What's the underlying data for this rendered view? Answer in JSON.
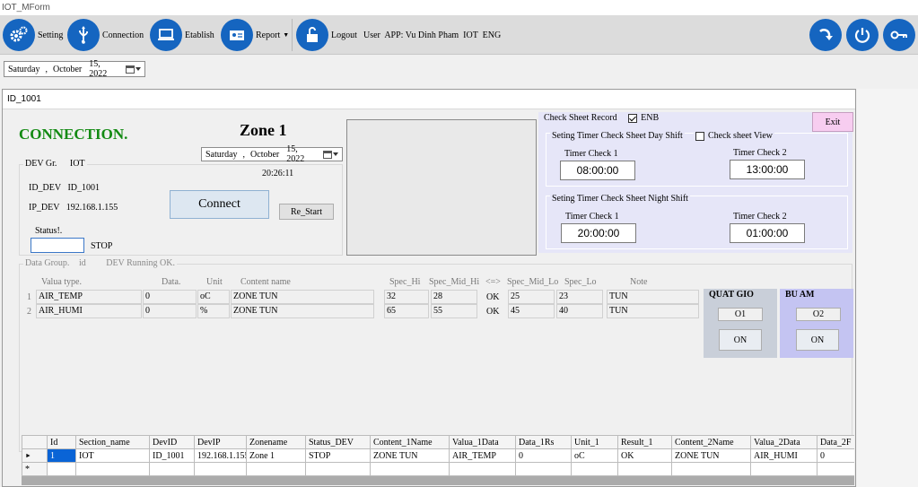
{
  "window": {
    "title": "IOT_MForm"
  },
  "toolbar": {
    "setting": "Setting",
    "connection": "Connection",
    "etablish": "Etablish",
    "report": "Report",
    "logout": "Logout",
    "user_info": "User  APP: Vu Dinh Pham  IOT  ENG"
  },
  "main_date": {
    "weekday": "Saturday",
    "sep": ",",
    "month": "October",
    "day_year": "15, 2022"
  },
  "child": {
    "title": "ID_1001",
    "connection_status": "CONNECTION.",
    "zone_title": "Zone 1",
    "date": {
      "weekday": "Saturday",
      "sep": ",",
      "month": "October",
      "day_year": "15, 2022"
    },
    "time": "20:26:11",
    "dev_group_label": "DEV Gr.",
    "dev_group_value": "IOT",
    "id_dev_label": "ID_DEV",
    "id_dev_value": "ID_1001",
    "ip_dev_label": "IP_DEV",
    "ip_dev_value": "192.168.1.155",
    "status_label": "Status!.",
    "status_value": "STOP",
    "connect_button": "Connect",
    "restart_button": "Re_Start"
  },
  "check_sheet": {
    "record_label": "Check Sheet Record",
    "enb_label": "ENB",
    "exit_button": "Exit",
    "day_title": "Seting Timer Check Sheet Day Shift",
    "view_label": "Check sheet View",
    "day_timer1_label": "Timer Check 1",
    "day_timer1_value": "08:00:00",
    "day_timer2_label": "Timer Check 2",
    "day_timer2_value": "13:00:00",
    "night_title": "Seting Timer Check Sheet Night Shift",
    "night_timer1_label": "Timer Check 1",
    "night_timer1_value": "20:00:00",
    "night_timer2_label": "Timer Check 2",
    "night_timer2_value": "01:00:00"
  },
  "data_group": {
    "title": "Data Group.",
    "id_label": "id",
    "running_label": "DEV Running OK.",
    "headers": {
      "type": "Valua type.",
      "data": "Data.",
      "unit": "Unit",
      "content": "Content name",
      "spec_hi": "Spec_Hi",
      "spec_mid_hi": "Spec_Mid_Hi",
      "compare": "<=>",
      "spec_mid_lo": "Spec_Mid_Lo",
      "spec_lo": "Spec_Lo",
      "note": "Note"
    },
    "rows": [
      {
        "num": "1",
        "type": "AIR_TEMP",
        "data": "0",
        "unit": "oC",
        "content": "ZONE TUN",
        "spec_hi": "32",
        "spec_mid_hi": "28",
        "ok": "OK",
        "spec_mid_lo": "25",
        "spec_lo": "23",
        "note": "TUN"
      },
      {
        "num": "2",
        "type": "AIR_HUMI",
        "data": "0",
        "unit": "%",
        "content": "ZONE TUN",
        "spec_hi": "65",
        "spec_mid_hi": "55",
        "ok": "OK",
        "spec_mid_lo": "45",
        "spec_lo": "40",
        "note": "TUN"
      }
    ]
  },
  "outputs": {
    "fan": {
      "title": "QUAT GIO",
      "channel": "O1",
      "state": "ON",
      "color": "#c9cfd9"
    },
    "humidifier": {
      "title": "BU AM",
      "channel": "O2",
      "state": "ON",
      "color": "#c4c4f2"
    }
  },
  "grid": {
    "headers": [
      "Id",
      "Section_name",
      "DevID",
      "DevIP",
      "Zonename",
      "Status_DEV",
      "Content_1Name",
      "Valua_1Data",
      "Data_1Rs",
      "Unit_1",
      "Result_1",
      "Content_2Name",
      "Valua_2Data",
      "Data_2F"
    ],
    "rows": [
      [
        "1",
        "IOT",
        "ID_1001",
        "192.168.1.155",
        "Zone 1",
        "STOP",
        "ZONE TUN",
        "AIR_TEMP",
        "0",
        "oC",
        "OK",
        "ZONE TUN",
        "AIR_HUMI",
        "0"
      ]
    ],
    "new_row_marker": "*"
  },
  "colors": {
    "icon_blue": "#1565c0",
    "connection_green": "#138a13",
    "exit_pink": "#f7cdf0",
    "selected_cell": "#0a64d6"
  }
}
